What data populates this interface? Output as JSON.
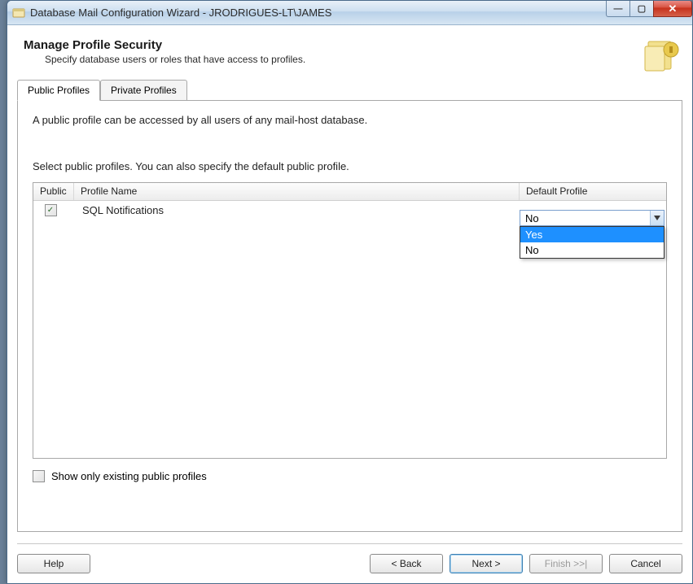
{
  "window": {
    "title": "Database Mail Configuration Wizard - JRODRIGUES-LT\\JAMES"
  },
  "header": {
    "title": "Manage Profile Security",
    "subtitle": "Specify database users or roles that have access to profiles."
  },
  "tabs": {
    "public": "Public Profiles",
    "private": "Private Profiles"
  },
  "body": {
    "desc1": "A public profile can be accessed by all users of any mail-host database.",
    "desc2": "Select public profiles. You can also specify the default public profile.",
    "columns": {
      "public": "Public",
      "name": "Profile Name",
      "default": "Default Profile"
    },
    "rows": [
      {
        "public_checked": true,
        "name": "SQL Notifications",
        "default_value": "No"
      }
    ],
    "default_options": {
      "opt1": "Yes",
      "opt2": "No"
    },
    "show_only_label": "Show only existing public profiles",
    "show_only_checked": false
  },
  "footer": {
    "help": "Help",
    "back": "< Back",
    "next": "Next >",
    "finish": "Finish >>|",
    "cancel": "Cancel"
  }
}
